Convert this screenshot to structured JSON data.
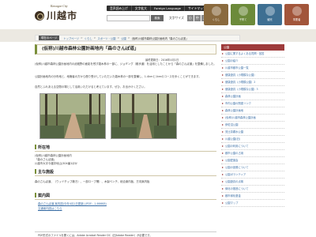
{
  "header": {
    "brand_sub": "Kawagoe City",
    "brand_name": "川越市",
    "utility": [
      "音声読み上げ",
      "文字拡大",
      "Foreign Language",
      "サイトマップ"
    ],
    "search_button": "検索",
    "size_label": "文字サイズ",
    "size_options": [
      "小",
      "中",
      "大"
    ],
    "nav": [
      "くらし",
      "子育て",
      "観光",
      "事業者"
    ]
  },
  "breadcrumb": {
    "home": "現在のページ",
    "items": [
      "トップページ",
      "くらし",
      "スポーツ・公園",
      "公園"
    ],
    "current": "(仮称)川越市森林公園計画地内「森のさんぽ道」"
  },
  "page": {
    "title": "(仮称)川越市森林公園計画地内「森のさんぽ道」",
    "date": "最終更新日：2016年4月1日",
    "intro": "(仮称)川越市森林公園計画地内の武蔵野の面影を残す雑木林の一部に、ジョギング（散歩道）を活用としたことから「森のさんぽ道」を整備しました。",
    "intro2": "公園計画地内の分布地と、地権者の方から借り受けしていただいた雑木林の一部を整備し、1.4kmと1kmのコースを歩くことができます。",
    "intro3": "自然とふれあえる空間の場として活用いただけると考えています。ぜひ、お出かけください。"
  },
  "location": {
    "heading": "所在地",
    "lines": [
      "(仮称)川越市森林公園計画地内",
      "「森のさんぽ道」",
      "川越市大字今福字地山(304番1ほか"
    ]
  },
  "facilities": {
    "heading": "主な施設",
    "text": "森のさんぽ道、（ウッドチップ敷き）、一部ロープ柵）、木製ベンチ、総合案内板、方向案内板"
  },
  "map": {
    "heading": "案内図",
    "links": [
      "森のさんぽ道 案内図(今年4月1日更新) (PDF：1,666KB)",
      "交通案内図はこちら"
    ]
  },
  "note": "PDF形式のファイルを開くには、Adobe Acrobat Reader DC（旧Adobe Reader）が必要です。",
  "sidebar": {
    "heading": "公園",
    "items": [
      "公園に関するよくある質問・回答",
      "公園の紹介",
      "川越市都市公園一覧",
      "健康遊具（小規模な公園）",
      "健康遊具（小規模公園）2",
      "健康遊具（小規模な公園）3",
      "森林公園計画",
      "市内公園の関連リンク",
      "森林公園計画地",
      "(仮称)川越市森林公園計画",
      "伊佐沼公園",
      "安比奈親水公園",
      "川越公園(旧)",
      "公園の利用について",
      "都市公園の占用",
      "公園愛護会",
      "公園の設置について",
      "公園ボランティア",
      "公園遊具の点検",
      "緑化の推進について",
      "都市緑化基金",
      "公園マップ"
    ]
  }
}
